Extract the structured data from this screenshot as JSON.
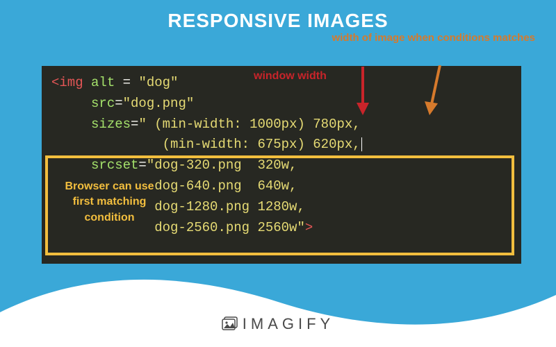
{
  "title": "RESPONSIVE IMAGES",
  "annotations": {
    "window_width": "window width",
    "image_width": "width of image\nwhen conditions\nmatches",
    "browser_note": "Browser can use first matching condition"
  },
  "code": {
    "l1_tag": "<img",
    "l1_attr": " alt ",
    "l1_eq": "= ",
    "l1_val": "\"dog\"",
    "l2_attr": "     src",
    "l2_eq": "=",
    "l2_val": "\"dog.png\"",
    "l3_attr": "     sizes",
    "l3_eq": "=",
    "l3_val": "\" (min-width: 1000px) 780px,",
    "l4_val": "              (min-width: 675px) 620px,",
    "l5_attr": "     srcset",
    "l5_eq": "=",
    "l5_val": "\"dog-320.png  320w,",
    "l6_val": "             dog-640.png  640w,",
    "l7_val": "             dog-1280.png 1280w,",
    "l8_val": "             dog-2560.png 2560w\"",
    "l8_close": ">"
  },
  "logo_text": "IMAGIFY"
}
